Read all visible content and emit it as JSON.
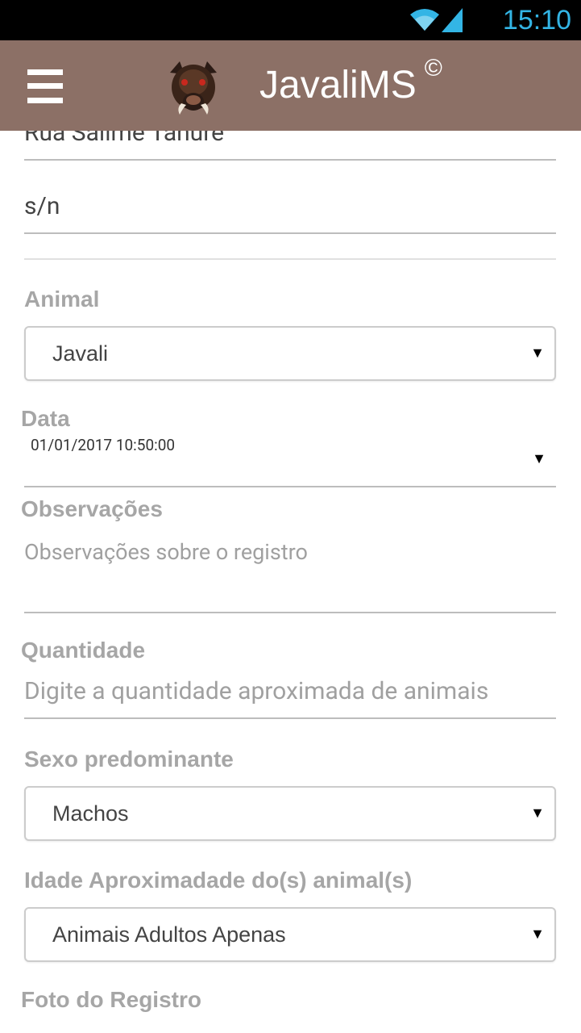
{
  "status_bar": {
    "time": "15:10",
    "wifi_icon": "wifi-icon",
    "signal_icon": "signal-icon"
  },
  "app_bar": {
    "title": "JavaliMS",
    "copyright": "©",
    "menu_icon": "hamburger-menu-icon",
    "logo": "boar-logo"
  },
  "form": {
    "street_value": "Rua Salime Tahure",
    "number_value": "s/n",
    "animal": {
      "label": "Animal",
      "selected": "Javali"
    },
    "date": {
      "label": "Data",
      "value": "01/01/2017 10:50:00"
    },
    "notes": {
      "label": "Observações",
      "placeholder": "Observações sobre o registro"
    },
    "quantity": {
      "label": "Quantidade",
      "placeholder": "Digite a quantidade aproximada de animais"
    },
    "sex": {
      "label": "Sexo predominante",
      "selected": "Machos"
    },
    "age": {
      "label": "Idade Aproximadade do(s) animal(s)",
      "selected": "Animais Adultos Apenas"
    },
    "photo": {
      "label": "Foto do Registro"
    }
  },
  "colors": {
    "app_bar": "#8c7066",
    "status_bar": "#000000",
    "clock": "#33b5e5",
    "label": "#a6a6a6"
  }
}
